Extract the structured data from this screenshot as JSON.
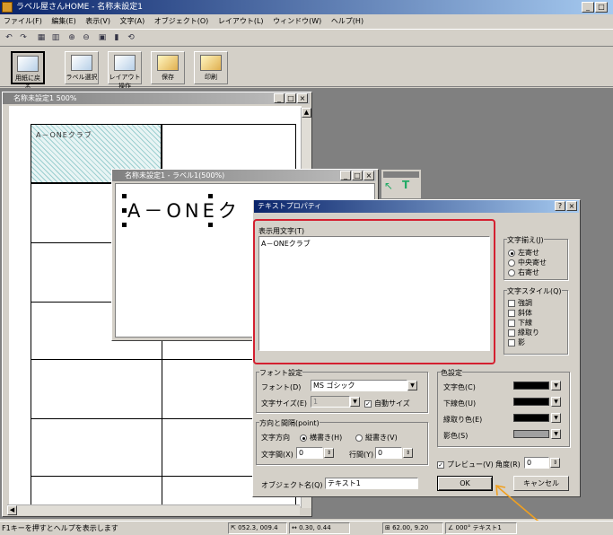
{
  "app": {
    "title": "ラベル屋さんHOME - 名称未設定1"
  },
  "menu": [
    "ファイル(F)",
    "編集(E)",
    "表示(V)",
    "文字(A)",
    "オブジェクト(O)",
    "レイアウト(L)",
    "ウィンドウ(W)",
    "ヘルプ(H)"
  ],
  "toolbar_big": [
    {
      "label": "用紙に戻る",
      "icon": "paper-return-icon"
    },
    {
      "label": "ラベル選択",
      "icon": "label-select-icon"
    },
    {
      "label": "レイアウト操作",
      "icon": "layout-icon"
    },
    {
      "label": "保存",
      "icon": "save-icon"
    },
    {
      "label": "印刷",
      "icon": "print-icon"
    }
  ],
  "doc_window": {
    "title": "名称未設定1 500%",
    "sample_text": "A－ONEクラブ"
  },
  "label_window": {
    "title": "名称未設定1 - ラベル1(500%)",
    "big_text": "A－ONEク"
  },
  "dialog": {
    "title": "テキストプロパティ",
    "help_close": "?|×",
    "display_text_label": "表示用文字(T)",
    "display_text_value": "A－ONEクラブ",
    "align": {
      "title": "文字揃え(J)",
      "options": [
        "左寄せ",
        "中央寄せ",
        "右寄せ"
      ],
      "selected": 0
    },
    "style": {
      "title": "文字スタイル(Q)",
      "options": [
        "強調",
        "斜体",
        "下線",
        "縁取り",
        "影"
      ]
    },
    "font_group": {
      "title": "フォント設定",
      "font_label": "フォント(D)",
      "font_value": "MS ゴシック",
      "size_label": "文字サイズ(E)",
      "size_value": "1",
      "auto_size_label": "自動サイズ"
    },
    "direction_group": {
      "title": "方向と間隔(point)",
      "dir_label": "文字方向",
      "horizontal": "横書き(H)",
      "vertical": "縦書き(V)",
      "char_spacing_label": "文字間(X)",
      "char_spacing_value": "0",
      "line_spacing_label": "行間(Y)",
      "line_spacing_value": "0"
    },
    "color_group": {
      "title": "色設定",
      "text_color": "文字色(C)",
      "underline_color": "下線色(U)",
      "outline_color": "縁取り色(E)",
      "shadow_color": "影色(S)",
      "colors": {
        "text": "#000000",
        "underline": "#000000",
        "outline": "#000000",
        "shadow": "#a0a0a0"
      }
    },
    "preview_label": "プレビュー(V)",
    "angle_label": "角度(R)",
    "angle_value": "0",
    "object_name_label": "オブジェクト名(Q)",
    "object_name_value": "テキスト1",
    "ok": "OK",
    "cancel": "キャンセル"
  },
  "status": {
    "hint": "F1キーを押すとヘルプを表示します",
    "pos": "052.3, 009.4",
    "size": "0.30, 0.44",
    "dim": "62.00, 9.20",
    "angle": "000° テキスト1"
  },
  "colors": {
    "highlight_box": "#d42030",
    "arrow": "#f0a020"
  }
}
